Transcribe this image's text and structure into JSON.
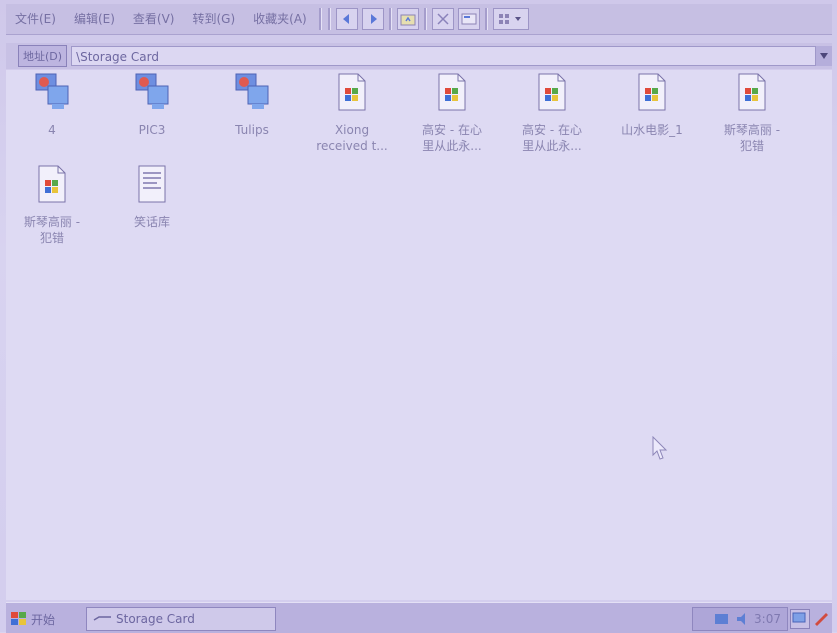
{
  "menubar": {
    "items": [
      "文件(E)",
      "编辑(E)",
      "查看(V)",
      "转到(G)",
      "收藏夹(A)"
    ]
  },
  "toolbar": {
    "buttons": [
      "back-icon",
      "forward-icon",
      "up-folder-icon",
      "delete-icon",
      "properties-icon",
      "views-icon"
    ]
  },
  "address": {
    "label": "地址(D)",
    "value": "\\Storage Card"
  },
  "files": [
    {
      "label": "4",
      "icon": "image-file-icon"
    },
    {
      "label": "PIC3",
      "icon": "image-file-icon"
    },
    {
      "label": "Tulips",
      "icon": "image-file-icon"
    },
    {
      "label": "Xiong\nreceived t...",
      "icon": "media-file-icon"
    },
    {
      "label": "高安 - 在心\n里从此永...",
      "icon": "media-file-icon"
    },
    {
      "label": "高安 - 在心\n里从此永...",
      "icon": "media-file-icon"
    },
    {
      "label": "山水电影_1",
      "icon": "media-file-icon"
    },
    {
      "label": "斯琴高丽 -\n犯错",
      "icon": "media-file-icon"
    },
    {
      "label": "斯琴高丽 -\n犯错",
      "icon": "media-file-icon"
    },
    {
      "label": "笑话库",
      "icon": "document-file-icon"
    }
  ],
  "taskbar": {
    "start_label": "开始",
    "task_label": "Storage Card",
    "clock": "3:07"
  },
  "colors": {
    "background": "#dedaf3",
    "menubar": "#c6bfe3",
    "taskbar": "#b9b1de"
  }
}
